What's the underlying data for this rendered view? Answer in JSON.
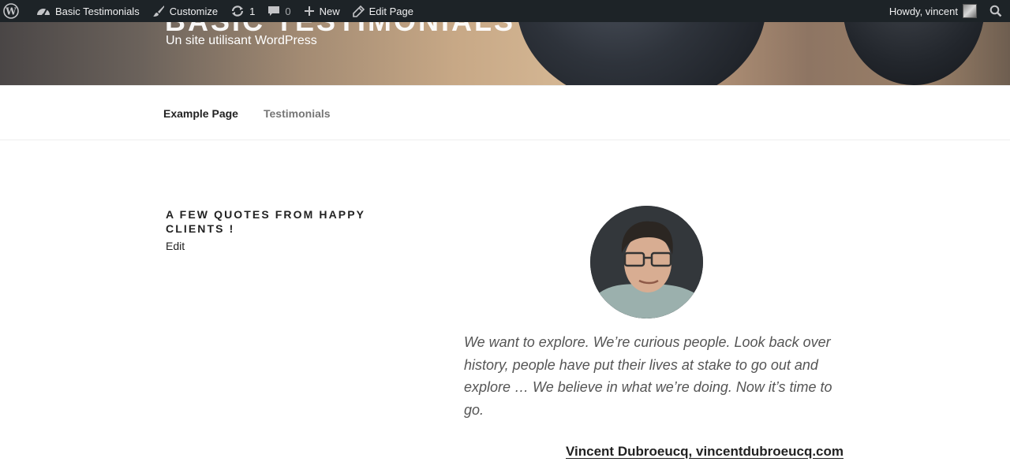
{
  "admin_bar": {
    "site_name": "Basic Testimonials",
    "customize": "Customize",
    "updates_count": "1",
    "comments_count": "0",
    "new_label": "New",
    "edit_page_label": "Edit Page",
    "howdy": "Howdy, vincent"
  },
  "header": {
    "site_title": "BASIC TESTIMONIALS",
    "description": "Un site utilisant WordPress"
  },
  "nav": {
    "items": [
      {
        "label": "Example Page"
      },
      {
        "label": "Testimonials"
      }
    ]
  },
  "page": {
    "title": "A FEW QUOTES FROM HAPPY CLIENTS !",
    "edit_label": "Edit"
  },
  "testimonial": {
    "quote": "We want to explore. We’re curious people. Look back over history, people have put their lives at stake to go out and explore … We believe in what we’re doing. Now it’s time to go.",
    "author": "Vincent Dubroeucq, vincentdubroeucq.com"
  },
  "colors": {
    "admin_bar_bg": "#1d2327",
    "text": "#222222",
    "muted_nav": "#767676"
  }
}
